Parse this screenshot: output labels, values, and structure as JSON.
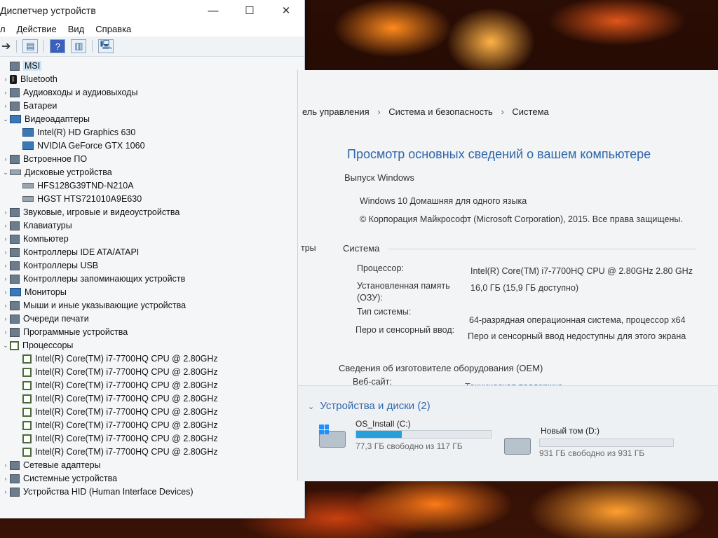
{
  "devmgr": {
    "title": "Диспетчер устройств",
    "menu": [
      "л",
      "Действие",
      "Вид",
      "Справка"
    ],
    "window_buttons": {
      "minimize": "—",
      "maximize": "☐",
      "close": "✕"
    },
    "root": "MSI",
    "categories": [
      {
        "label": "Bluetooth",
        "expanded": false,
        "icon": "bluetooth-icon"
      },
      {
        "label": "Аудиовходы и аудиовыходы",
        "expanded": false,
        "icon": "speaker-icon"
      },
      {
        "label": "Батареи",
        "expanded": false,
        "icon": "battery-icon"
      },
      {
        "label": "Видеоадаптеры",
        "expanded": true,
        "icon": "monitor-icon",
        "children": [
          "Intel(R) HD Graphics 630",
          "NVIDIA GeForce GTX 1060"
        ]
      },
      {
        "label": "Встроенное ПО",
        "expanded": false,
        "icon": "firmware-icon"
      },
      {
        "label": "Дисковые устройства",
        "expanded": true,
        "icon": "disk-icon",
        "children": [
          "HFS128G39TND-N210A",
          "HGST HTS721010A9E630"
        ]
      },
      {
        "label": "Звуковые, игровые и видеоустройства",
        "expanded": false,
        "icon": "sound-icon"
      },
      {
        "label": "Клавиатуры",
        "expanded": false,
        "icon": "keyboard-icon"
      },
      {
        "label": "Компьютер",
        "expanded": false,
        "icon": "computer-icon"
      },
      {
        "label": "Контроллеры IDE ATA/ATAPI",
        "expanded": false,
        "icon": "ide-controller-icon"
      },
      {
        "label": "Контроллеры USB",
        "expanded": false,
        "icon": "usb-icon"
      },
      {
        "label": "Контроллеры запоминающих устройств",
        "expanded": false,
        "icon": "storage-controller-icon"
      },
      {
        "label": "Мониторы",
        "expanded": false,
        "icon": "monitor-icon"
      },
      {
        "label": "Мыши и иные указывающие устройства",
        "expanded": false,
        "icon": "mouse-icon"
      },
      {
        "label": "Очереди печати",
        "expanded": false,
        "icon": "printer-icon"
      },
      {
        "label": "Программные устройства",
        "expanded": false,
        "icon": "software-device-icon"
      },
      {
        "label": "Процессоры",
        "expanded": true,
        "icon": "cpu-icon",
        "children": [
          "Intel(R) Core(TM) i7-7700HQ CPU @ 2.80GHz",
          "Intel(R) Core(TM) i7-7700HQ CPU @ 2.80GHz",
          "Intel(R) Core(TM) i7-7700HQ CPU @ 2.80GHz",
          "Intel(R) Core(TM) i7-7700HQ CPU @ 2.80GHz",
          "Intel(R) Core(TM) i7-7700HQ CPU @ 2.80GHz",
          "Intel(R) Core(TM) i7-7700HQ CPU @ 2.80GHz",
          "Intel(R) Core(TM) i7-7700HQ CPU @ 2.80GHz",
          "Intel(R) Core(TM) i7-7700HQ CPU @ 2.80GHz"
        ]
      },
      {
        "label": "Сетевые адаптеры",
        "expanded": false,
        "icon": "network-icon"
      },
      {
        "label": "Системные устройства",
        "expanded": false,
        "icon": "system-device-icon"
      },
      {
        "label": "Устройства HID (Human Interface Devices)",
        "expanded": false,
        "icon": "hid-icon"
      }
    ]
  },
  "system": {
    "breadcrumb": [
      "ель управления",
      "Система и безопасность",
      "Система"
    ],
    "heading": "Просмотр основных сведений о вашем компьютере",
    "edition_section": "Выпуск Windows",
    "edition": "Windows 10 Домашняя для одного языка",
    "copyright": "© Корпорация Майкрософт (Microsoft Corporation), 2015. Все права защищены.",
    "left_fragment": "тры",
    "system_section": "Система",
    "rows": [
      {
        "label": "Процессор:",
        "value": "Intel(R) Core(TM) i7-7700HQ CPU @ 2.80GHz   2.80 GHz"
      },
      {
        "label": "Установленная память (ОЗУ):",
        "value": "16,0 ГБ (15,9 ГБ доступно)"
      },
      {
        "label": "Тип системы:",
        "value": "64-разрядная операционная система, процессор x64"
      },
      {
        "label": "Перо и сенсорный ввод:",
        "value": "Перо и сенсорный ввод недоступны для этого экрана"
      }
    ],
    "oem_section": "Сведения об изготовителе оборудования (OEM)",
    "website_label": "Веб-сайт:",
    "website_link": "Техническая поддержка"
  },
  "drives": {
    "header": "Устройства и диски (2)",
    "items": [
      {
        "name": "OS_Install (C:)",
        "free_text": "77,3 ГБ свободно из 117 ГБ",
        "used_fraction": 0.34
      },
      {
        "name": "Новый том (D:)",
        "free_text": "931 ГБ свободно из 931 ГБ",
        "used_fraction": 0.0
      }
    ]
  },
  "colors": {
    "accent": "#2e66aa",
    "bar_fill": "#26a0da"
  }
}
